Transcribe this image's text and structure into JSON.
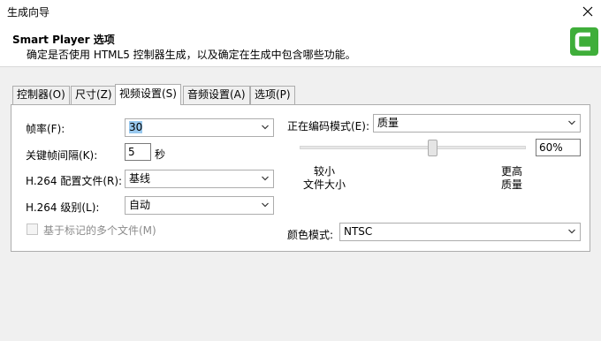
{
  "window": {
    "title": "生成向导"
  },
  "header": {
    "title": "Smart Player 选项",
    "description": "确定是否使用 HTML5 控制器生成，以及确定在生成中包含哪些功能。",
    "logo_color": "#3fae3a"
  },
  "tabs": [
    {
      "label": "控制器(O)",
      "active": false
    },
    {
      "label": "尺寸(Z)",
      "active": false
    },
    {
      "label": "视频设置(S)",
      "active": true
    },
    {
      "label": "音频设置(A)",
      "active": false
    },
    {
      "label": "选项(P)",
      "active": false
    }
  ],
  "video": {
    "frame_rate_label": "帧率(F):",
    "frame_rate_value": "30",
    "keyframe_label": "关键帧间隔(K):",
    "keyframe_value": "5",
    "keyframe_unit": "秒",
    "profile_label": "H.264 配置文件(R):",
    "profile_value": "基线",
    "level_label": "H.264 级别(L):",
    "level_value": "自动",
    "multi_file_label": "基于标记的多个文件(M)",
    "multi_file_checked": false,
    "multi_file_enabled": false,
    "encoding_mode_label": "正在编码模式(E):",
    "encoding_mode_value": "质量",
    "quality_percent": "60%",
    "quality_level": 0.6,
    "slider_min_line1": "较小",
    "slider_min_line2": "文件大小",
    "slider_max_line1": "更高",
    "slider_max_line2": "质量",
    "color_mode_label": "颜色模式:",
    "color_mode_value": "NTSC"
  }
}
